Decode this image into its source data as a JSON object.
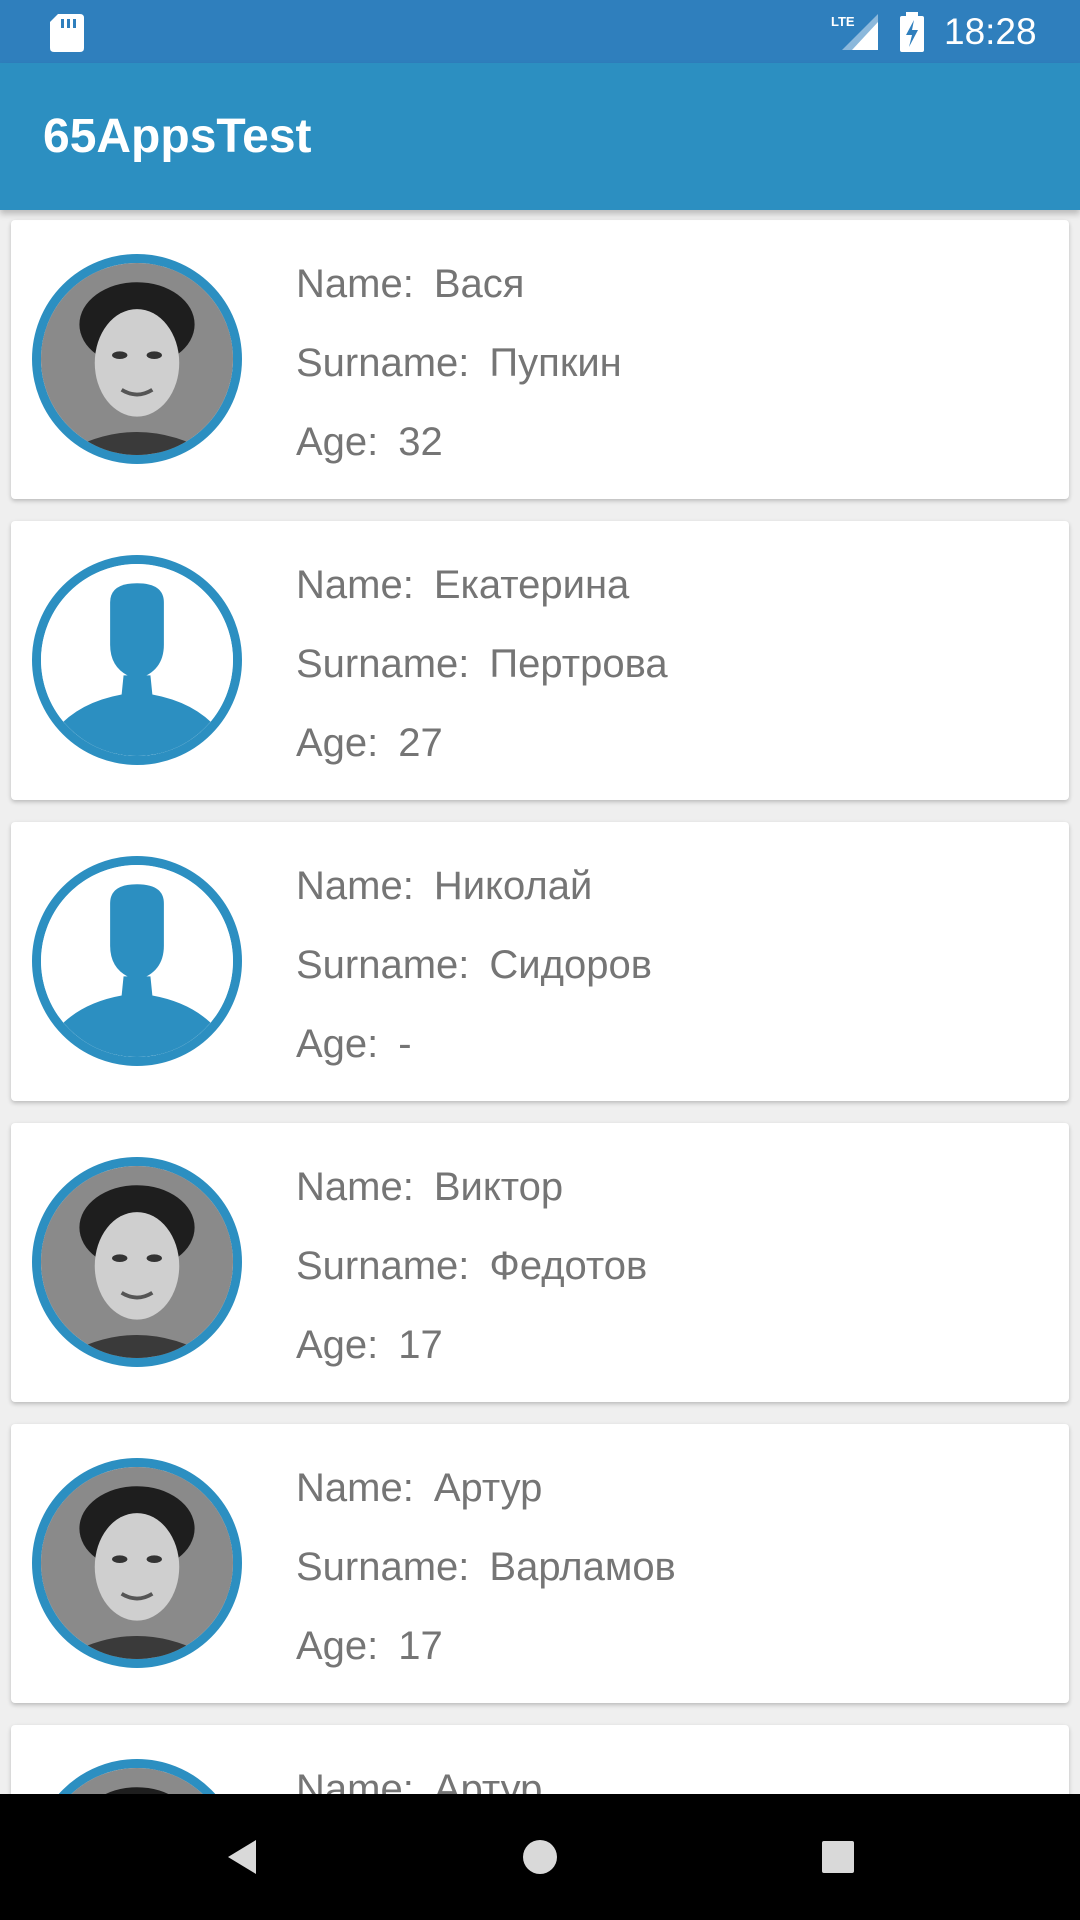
{
  "status_bar": {
    "time": "18:28",
    "icons": [
      "sd-card-icon",
      "lte-signal-icon",
      "battery-charging-icon"
    ]
  },
  "app_bar": {
    "title": "65AppsTest"
  },
  "labels": {
    "name": "Name:",
    "surname": "Surname:",
    "age": "Age:"
  },
  "people": [
    {
      "name": "Вася",
      "surname": "Пупкин",
      "age": "32",
      "avatar": "photo"
    },
    {
      "name": "Екатерина",
      "surname": "Пертрова",
      "age": "27",
      "avatar": "placeholder-person-icon"
    },
    {
      "name": "Николай",
      "surname": "Сидоров",
      "age": "-",
      "avatar": "placeholder-person-icon"
    },
    {
      "name": "Виктор",
      "surname": "Федотов",
      "age": "17",
      "avatar": "photo"
    },
    {
      "name": "Артур",
      "surname": "Варламов",
      "age": "17",
      "avatar": "photo"
    },
    {
      "name": "Артур",
      "surname": "",
      "age": "",
      "avatar": "photo"
    }
  ],
  "nav_bar": {
    "buttons": [
      "back-icon",
      "home-icon",
      "recents-icon"
    ]
  },
  "colors": {
    "status_bar": "#2f7fbd",
    "app_bar": "#2c8fc1",
    "avatar_ring": "#2c8fc1",
    "text_secondary": "#757575",
    "background": "#efefef"
  }
}
